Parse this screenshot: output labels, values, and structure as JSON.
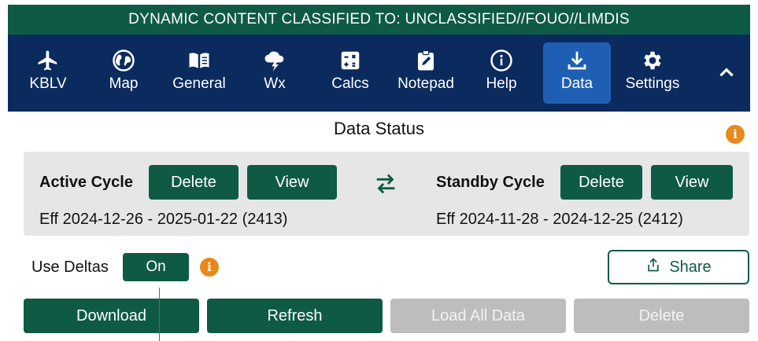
{
  "banner": {
    "text": "DYNAMIC CONTENT CLASSIFIED TO: UNCLASSIFIED//FOUO//LIMDIS"
  },
  "nav": {
    "items": [
      {
        "label": "KBLV",
        "icon": "airplane-icon"
      },
      {
        "label": "Map",
        "icon": "globe-icon"
      },
      {
        "label": "General",
        "icon": "book-icon"
      },
      {
        "label": "Wx",
        "icon": "storm-cloud-icon"
      },
      {
        "label": "Calcs",
        "icon": "calculator-icon"
      },
      {
        "label": "Notepad",
        "icon": "notepad-icon"
      },
      {
        "label": "Help",
        "icon": "info-icon"
      },
      {
        "label": "Data",
        "icon": "download-icon",
        "active": true
      },
      {
        "label": "Settings",
        "icon": "gear-icon"
      }
    ],
    "collapse_icon": "chevron-up-icon"
  },
  "data_status": {
    "title": "Data Status",
    "active": {
      "label": "Active Cycle",
      "delete_label": "Delete",
      "view_label": "View",
      "eff": "Eff 2024-12-26 - 2025-01-22 (2413)"
    },
    "standby": {
      "label": "Standby Cycle",
      "delete_label": "Delete",
      "view_label": "View",
      "eff": "Eff 2024-11-28 - 2024-12-25 (2412)"
    },
    "swap_icon": "swap-arrows-icon"
  },
  "deltas": {
    "label": "Use Deltas",
    "toggle_value": "On"
  },
  "share": {
    "label": "Share",
    "icon": "share-icon"
  },
  "actions": {
    "download": "Download",
    "refresh": "Refresh",
    "load_all": "Load All Data",
    "delete": "Delete"
  },
  "info_badge_glyph": "i",
  "colors": {
    "banner": "#0e5a45",
    "navbar": "#0b2a5e",
    "nav_active": "#1f5fb3",
    "button": "#0e5a45",
    "button_disabled": "#bdbdbd",
    "info": "#e8891c",
    "panel": "#e6e6e6"
  }
}
